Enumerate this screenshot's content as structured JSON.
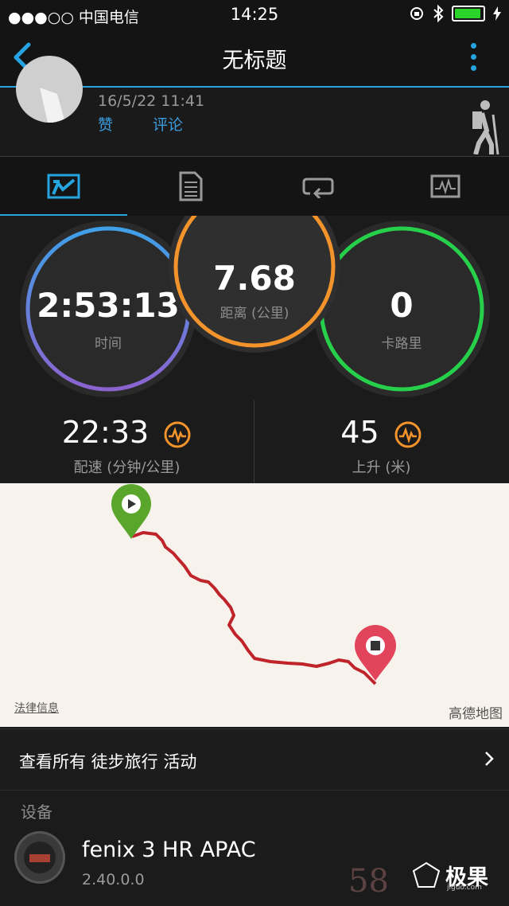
{
  "status_bar": {
    "carrier": "●●●○○ 中国电信",
    "time": "14:25"
  },
  "nav": {
    "title": "无标题"
  },
  "header": {
    "date": "16/5/22 11:41",
    "like": "赞",
    "comment": "评论"
  },
  "stats": {
    "time": {
      "value": "2:53:13",
      "label": "时间"
    },
    "distance": {
      "value": "7.68",
      "label": "距离 (公里)"
    },
    "calories": {
      "value": "0",
      "label": "卡路里"
    },
    "pace": {
      "value": "22:33",
      "label": "配速 (分钟/公里)"
    },
    "ascent": {
      "value": "45",
      "label": "上升 (米)"
    }
  },
  "map": {
    "legal": "法律信息",
    "provider": "高德地图"
  },
  "view_all": {
    "label": "查看所有 徒步旅行 活动"
  },
  "device": {
    "section_title": "设备",
    "name": "fenix 3 HR APAC",
    "version": "2.40.0.0"
  },
  "watermark": {
    "brand": "极果",
    "site": "jiguo.com",
    "number": "58"
  },
  "colors": {
    "accent": "#26a4e0",
    "time_ring": "#7b6fd6",
    "distance_ring": "#f2932b",
    "calories_ring": "#27d04a",
    "route": "#c0242b"
  }
}
